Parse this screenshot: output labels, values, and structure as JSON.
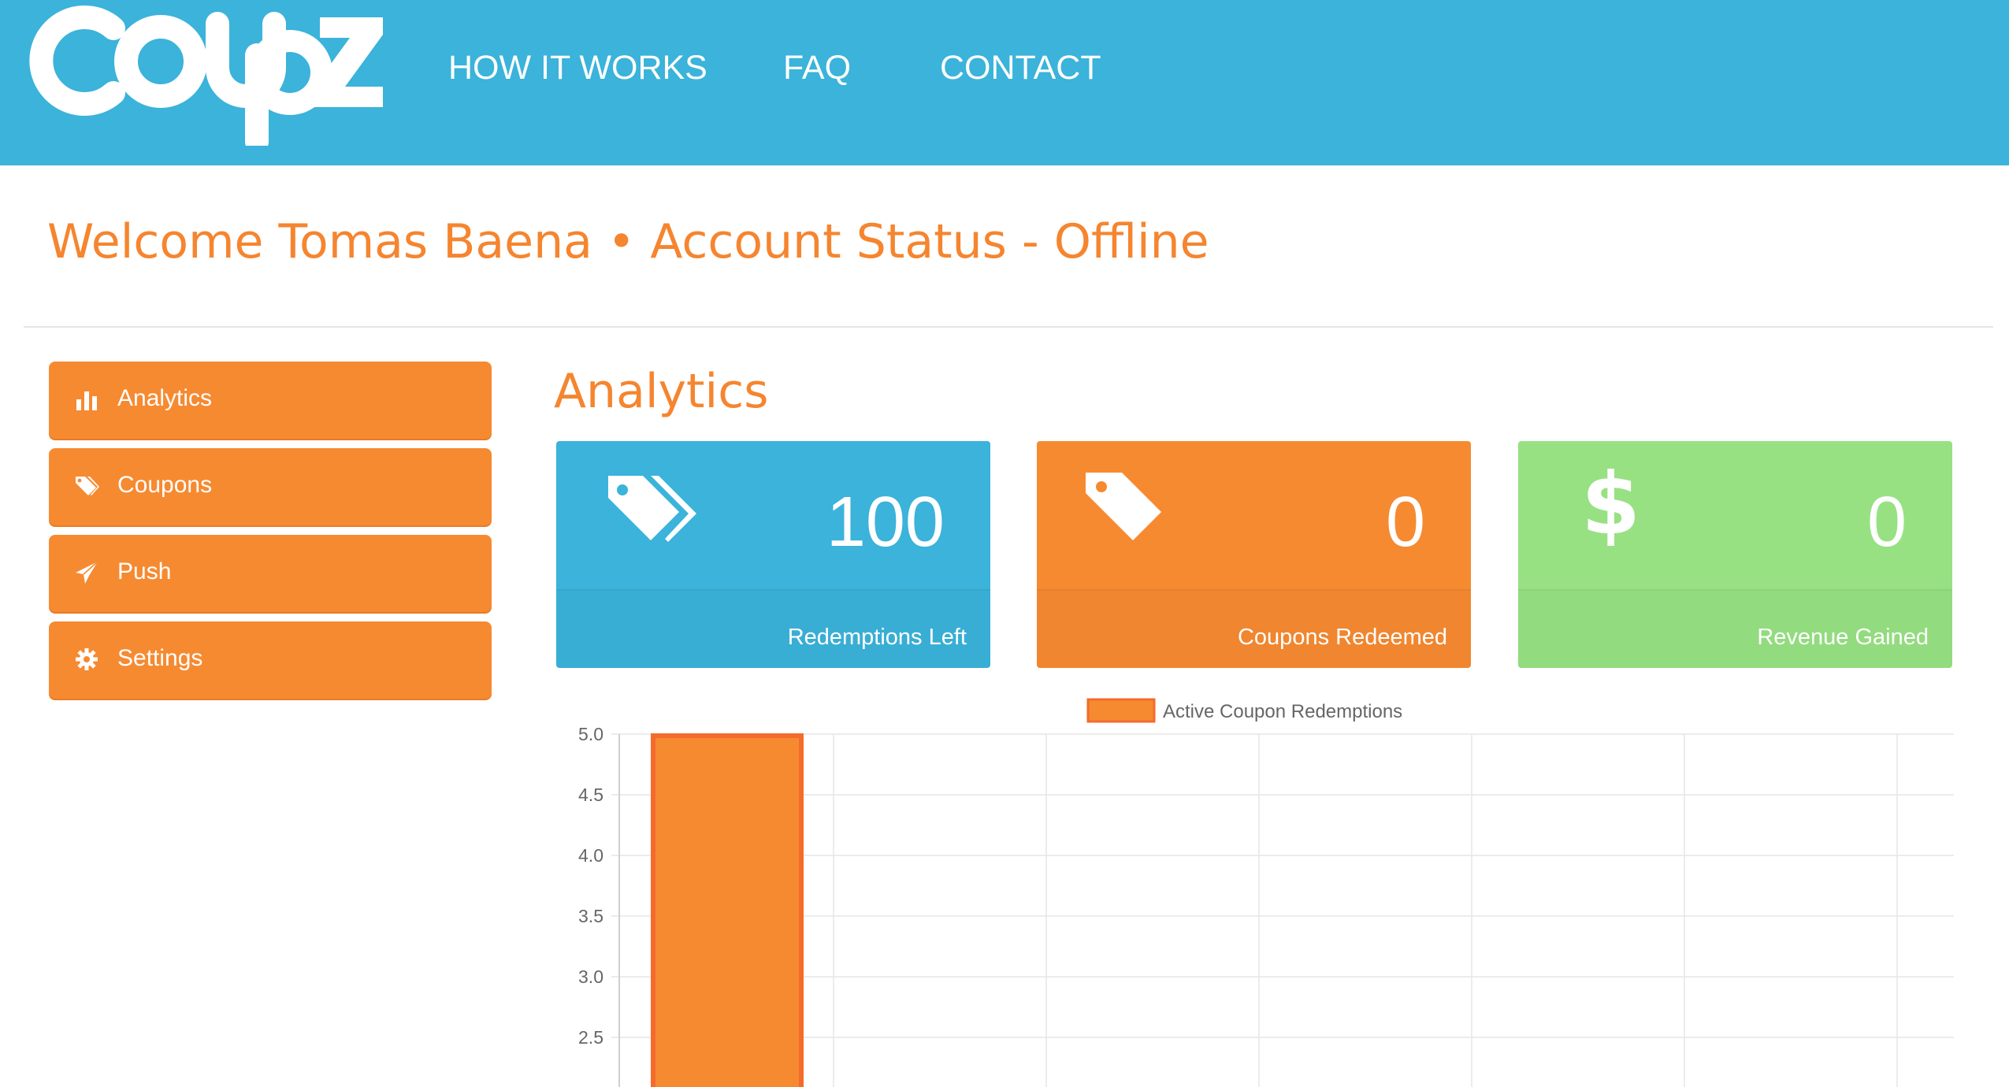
{
  "header": {
    "logo_text": "coupz",
    "nav": [
      "HOW IT WORKS",
      "FAQ",
      "CONTACT"
    ],
    "bg_color": "#3bb3da"
  },
  "welcome": {
    "text": "Welcome Tomas Baena • Account Status - Offline",
    "color": "#f5852f"
  },
  "sidebar": {
    "items": [
      {
        "label": "Analytics",
        "icon": "bar-chart-icon"
      },
      {
        "label": "Coupons",
        "icon": "tags-icon"
      },
      {
        "label": "Push",
        "icon": "paper-plane-icon"
      },
      {
        "label": "Settings",
        "icon": "gear-icon"
      }
    ],
    "color": "#f68a31"
  },
  "main": {
    "title": "Analytics",
    "cards": [
      {
        "value": "100",
        "label": "Redemptions Left",
        "icon": "tags-icon",
        "color": "#3bb3da"
      },
      {
        "value": "0",
        "label": "Coupons Redeemed",
        "icon": "tag-icon",
        "color": "#f68a31"
      },
      {
        "value": "0",
        "label": "Revenue Gained",
        "icon": "dollar-icon",
        "symbol": "$",
        "color": "#97e183"
      }
    ]
  },
  "chart_data": {
    "type": "bar",
    "legend": [
      "Active Coupon Redemptions"
    ],
    "legend_position": "top",
    "series": [
      {
        "name": "Active Coupon Redemptions",
        "values": [
          5
        ],
        "color": "#f68a31",
        "border_color": "#f46b2b"
      }
    ],
    "y_ticks": [
      "5.0",
      "4.5",
      "4.0",
      "3.5",
      "3.0",
      "2.5"
    ],
    "y_tick_values": [
      5.0,
      4.5,
      4.0,
      3.5,
      3.0,
      2.5
    ],
    "ylim_visible": [
      2.5,
      5.0
    ],
    "grid": true,
    "category_count_visible": 6
  }
}
